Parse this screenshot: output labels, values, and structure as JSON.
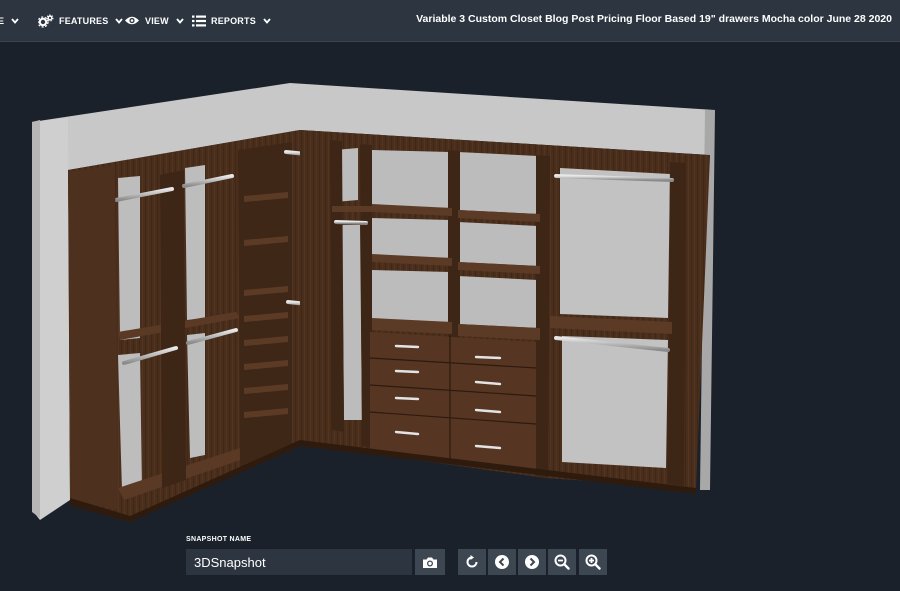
{
  "nav": {
    "items": [
      {
        "label": "E",
        "icon": "menu-icon"
      },
      {
        "label": "FEATURES",
        "icon": "gears-icon"
      },
      {
        "label": "VIEW",
        "icon": "eye-icon"
      },
      {
        "label": "REPORTS",
        "icon": "list-icon"
      }
    ],
    "project_title": "Variable 3 Custom Closet Blog Post Pricing Floor Based 19\" drawers Mocha color June 28 2020"
  },
  "viewport": {
    "scene": "closet-3d-render",
    "wood_color": "#4a2e1c",
    "wall_color": "#c4c4c4"
  },
  "snapshot": {
    "label": "SNAPSHOT NAME",
    "value": "3DSnapshot"
  },
  "toolbar": {
    "buttons": [
      "camera-icon",
      "reset-icon",
      "prev-icon",
      "next-icon",
      "zoom-out-icon",
      "zoom-in-icon"
    ]
  },
  "colors": {
    "background": "#1a212b",
    "topbar": "#2c3540",
    "button": "#3d4752"
  }
}
